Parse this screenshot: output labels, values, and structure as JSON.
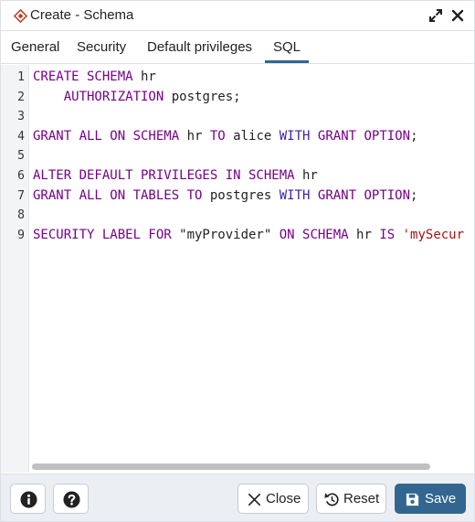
{
  "window": {
    "title": "Create - Schema",
    "icon": "schema-diamond-icon",
    "controls": [
      "expand-icon",
      "close-icon"
    ],
    "accent_color": "#326690"
  },
  "tabs": [
    {
      "label": "General",
      "active": false
    },
    {
      "label": "Security",
      "active": false
    },
    {
      "label": "Default privileges",
      "active": false
    },
    {
      "label": "SQL",
      "active": true
    }
  ],
  "editor": {
    "line_numbers": [
      "1",
      "2",
      "3",
      "4",
      "5",
      "6",
      "7",
      "8",
      "9"
    ],
    "lines": [
      [
        {
          "t": "CREATE SCHEMA",
          "c": "kw"
        },
        {
          "t": " hr",
          "c": "plain"
        }
      ],
      [
        {
          "t": "    ",
          "c": "plain"
        },
        {
          "t": "AUTHORIZATION",
          "c": "kw"
        },
        {
          "t": " postgres;",
          "c": "plain"
        }
      ],
      [],
      [
        {
          "t": "GRANT ALL ON SCHEMA",
          "c": "kw"
        },
        {
          "t": " hr ",
          "c": "plain"
        },
        {
          "t": "TO",
          "c": "kw"
        },
        {
          "t": " alice ",
          "c": "plain"
        },
        {
          "t": "WITH",
          "c": "kw2"
        },
        {
          "t": " ",
          "c": "plain"
        },
        {
          "t": "GRANT OPTION",
          "c": "kw"
        },
        {
          "t": ";",
          "c": "plain"
        }
      ],
      [],
      [
        {
          "t": "ALTER DEFAULT PRIVILEGES IN SCHEMA",
          "c": "kw"
        },
        {
          "t": " hr",
          "c": "plain"
        }
      ],
      [
        {
          "t": "GRANT ALL ON TABLES TO",
          "c": "kw"
        },
        {
          "t": " postgres ",
          "c": "plain"
        },
        {
          "t": "WITH",
          "c": "kw2"
        },
        {
          "t": " ",
          "c": "plain"
        },
        {
          "t": "GRANT OPTION",
          "c": "kw"
        },
        {
          "t": ";",
          "c": "plain"
        }
      ],
      [],
      [
        {
          "t": "SECURITY LABEL FOR",
          "c": "kw"
        },
        {
          "t": " \"myProvider\" ",
          "c": "plain"
        },
        {
          "t": "ON SCHEMA",
          "c": "kw"
        },
        {
          "t": " hr ",
          "c": "plain"
        },
        {
          "t": "IS",
          "c": "kw"
        },
        {
          "t": " ",
          "c": "plain"
        },
        {
          "t": "'mySecur",
          "c": "str"
        }
      ]
    ]
  },
  "footer": {
    "info_icon": "info-icon",
    "help_icon": "help-icon",
    "close_label": "Close",
    "reset_label": "Reset",
    "save_label": "Save"
  }
}
